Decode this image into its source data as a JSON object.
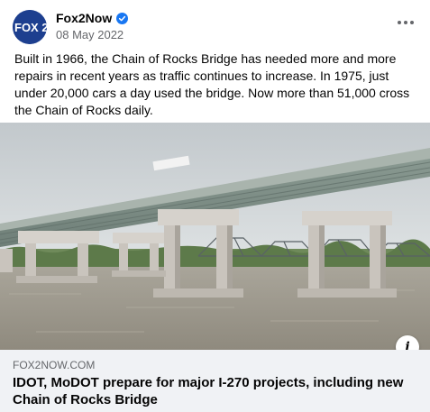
{
  "post": {
    "page_name": "Fox2Now",
    "avatar_text": "FOX 2",
    "date": "08 May 2022",
    "more_icon": "more-horizontal-icon",
    "verified_icon": "verified-badge-icon",
    "text": "Built in 1966, the Chain of Rocks Bridge has needed more and more repairs in recent years as traffic continues to increase. In 1975, just under 20,000 cars a day used the bridge. Now more than 51,000 cross the Chain of Rocks daily."
  },
  "link": {
    "domain": "FOX2NOW.COM",
    "title": "IDOT, MoDOT prepare for major I-270 projects, including new Chain of Rocks Bridge",
    "info_icon": "info-icon",
    "info_glyph": "i"
  },
  "colors": {
    "brand_blue": "#1877f2",
    "avatar_blue": "#1d3f8f",
    "secondary_text": "#65676b",
    "footer_bg": "#f0f2f5"
  }
}
